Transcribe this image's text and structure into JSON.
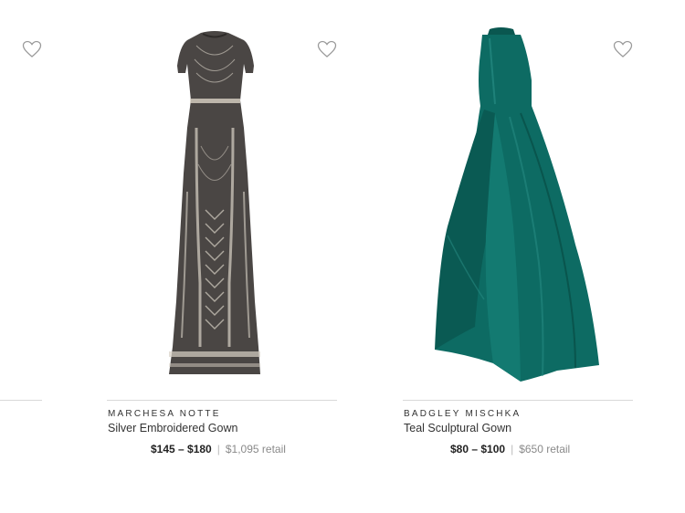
{
  "products": [
    {
      "brand": "MARCHESA NOTTE",
      "name": "Silver Embroidered Gown",
      "price_range": "$145 – $180",
      "retail": "$1,095 retail",
      "favorite_icon": "heart-outline-icon",
      "colors": {
        "dress": "#4a4644",
        "pattern": "#d9d2c6"
      }
    },
    {
      "brand": "BADGLEY MISCHKA",
      "name": "Teal Sculptural Gown",
      "price_range": "$80 – $100",
      "retail": "$650 retail",
      "favorite_icon": "heart-outline-icon",
      "colors": {
        "dress": "#0d6b63",
        "shadow": "#06463f",
        "highlight": "#2a9088"
      }
    }
  ],
  "left_partial": {
    "favorite_icon": "heart-outline-icon"
  }
}
